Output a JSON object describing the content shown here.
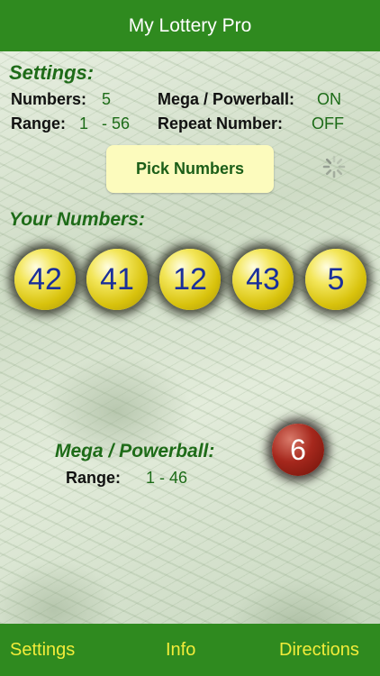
{
  "header": {
    "title": "My Lottery Pro"
  },
  "settings": {
    "title": "Settings:",
    "numbers_label": "Numbers:",
    "numbers_value": "5",
    "range_label": "Range:",
    "range_min": "1",
    "range_max": "- 56",
    "mega_label": "Mega / Powerball:",
    "mega_value": "ON",
    "repeat_label": "Repeat Number:",
    "repeat_value": "OFF"
  },
  "pick_button": {
    "label": "Pick Numbers"
  },
  "your_numbers": {
    "title": "Your Numbers:",
    "balls": [
      "42",
      "41",
      "12",
      "43",
      "5"
    ]
  },
  "powerball": {
    "title": "Mega / Powerball:",
    "range_label": "Range:",
    "range_value": "1 -  46",
    "number": "6"
  },
  "tabs": {
    "settings": "Settings",
    "info": "Info",
    "directions": "Directions"
  },
  "colors": {
    "header_green": "#2f8a1f",
    "tab_text_yellow": "#f2ec3a",
    "ball_number_blue": "#1a2f9a",
    "powerball_red": "#a6281d"
  }
}
